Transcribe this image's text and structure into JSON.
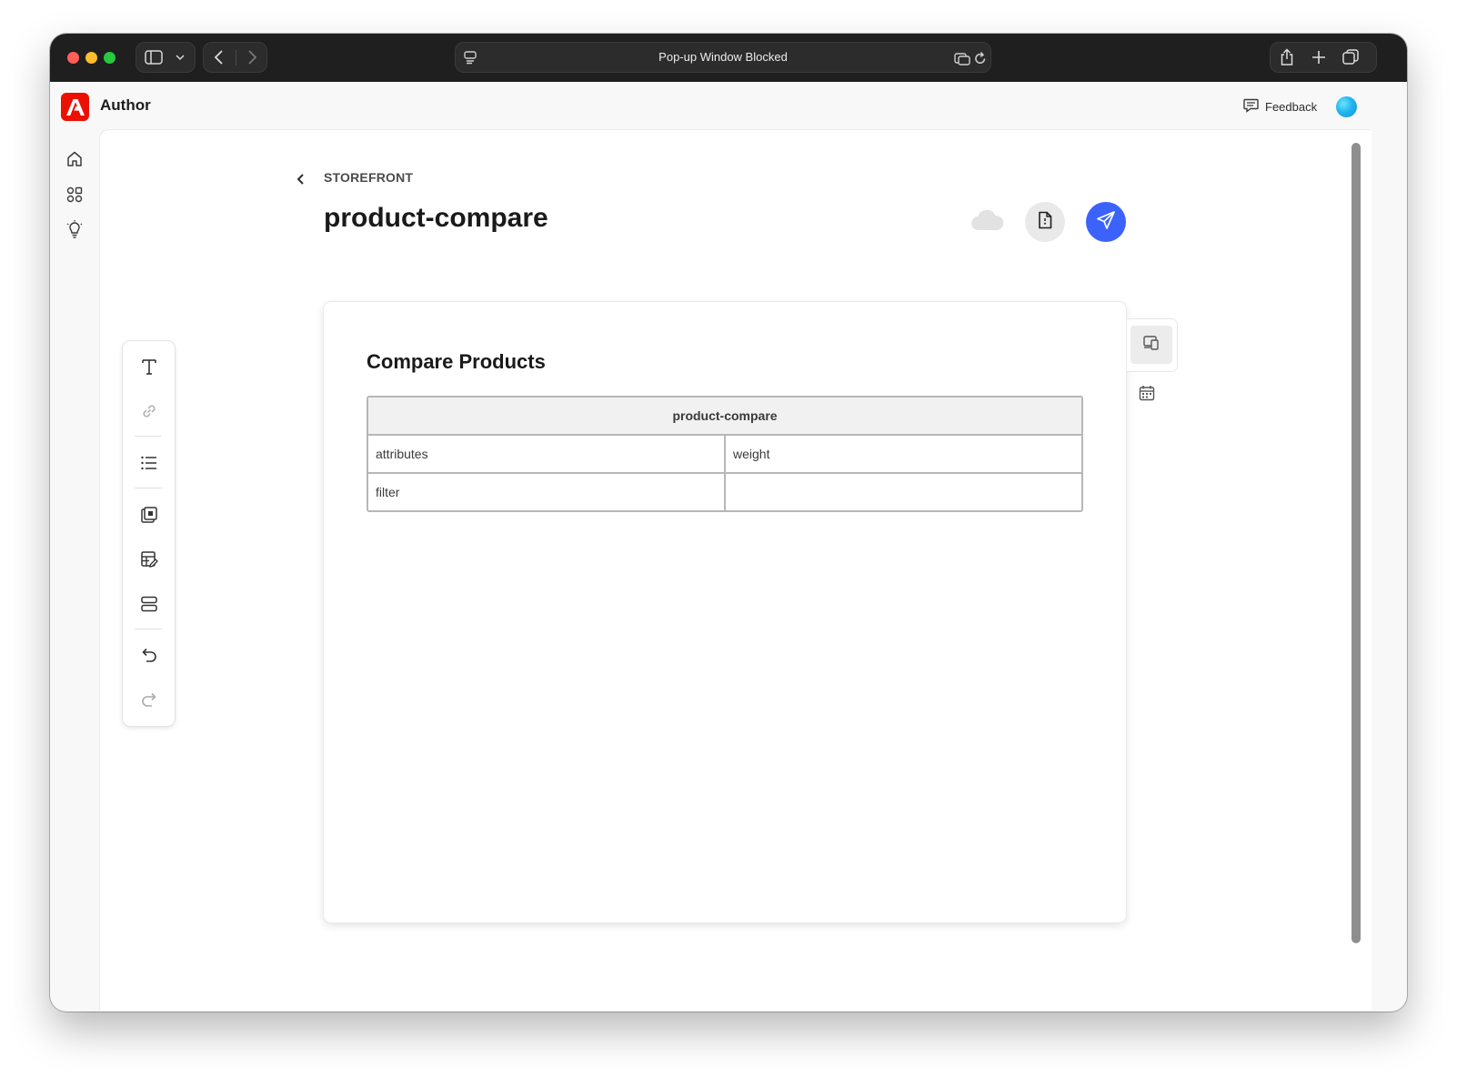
{
  "browser": {
    "url_title": "Pop-up Window Blocked"
  },
  "app": {
    "name": "Author",
    "feedback_label": "Feedback",
    "brand_color": "#eb1000",
    "accent_color": "#3b63fb"
  },
  "nav": {
    "items": [
      {
        "icon": "home-icon"
      },
      {
        "icon": "apps-icon"
      },
      {
        "icon": "lightbulb-icon"
      }
    ]
  },
  "header": {
    "breadcrumb": "STOREFRONT",
    "title": "product-compare"
  },
  "toolbar": {
    "tools": [
      "text-icon",
      "link-icon",
      "list-icon",
      "fragment-icon",
      "form-edit-icon",
      "blocks-icon",
      "undo-icon",
      "redo-icon"
    ]
  },
  "document": {
    "heading": "Compare Products",
    "block": {
      "name": "product-compare",
      "rows": [
        [
          "attributes",
          "weight"
        ],
        [
          "filter",
          ""
        ]
      ]
    }
  }
}
